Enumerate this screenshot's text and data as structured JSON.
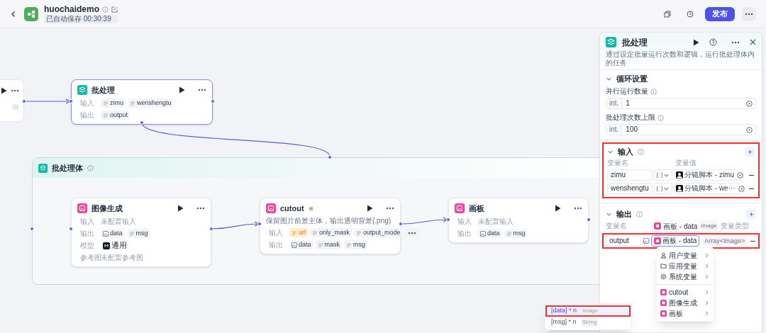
{
  "header": {
    "title": "huochaidemo",
    "autosave": "已自动保存 00:30:39",
    "publish": "发布"
  },
  "canvas": {
    "batch_node": {
      "kind": "batch",
      "color": "#14b8a6",
      "title": "批处理",
      "rows": [
        {
          "label": "输入",
          "chips": [
            {
              "kind": "text",
              "text": "zimu"
            },
            {
              "kind": "text",
              "text": "wenshengtu"
            }
          ]
        },
        {
          "label": "输出",
          "chips": [
            {
              "kind": "text",
              "text": "output"
            }
          ]
        }
      ]
    },
    "loop_body": {
      "title": "批处理体",
      "nodes": [
        {
          "kind": "plugin",
          "color": "#ec4899",
          "title": "图像生成",
          "rows": [
            {
              "label": "输入",
              "note": "未配置输入"
            },
            {
              "label": "输出",
              "chips": [
                {
                  "kind": "image",
                  "text": "data"
                },
                {
                  "kind": "text",
                  "text": "msg"
                }
              ]
            },
            {
              "label": "模型",
              "chips": [
                {
                  "kind": "model",
                  "text": "通用"
                }
              ]
            },
            {
              "label": "参考图",
              "note": "未配置参考图"
            }
          ]
        },
        {
          "kind": "plugin",
          "color": "#ec4899",
          "title": "cutout",
          "description": "保留图片前景主体，输出透明背景(.png)",
          "rows": [
            {
              "label": "输入",
              "chips": [
                {
                  "kind": "warn",
                  "text": "url"
                },
                {
                  "kind": "text",
                  "text": "only_mask"
                },
                {
                  "kind": "text",
                  "text": "output_mode"
                },
                {
                  "kind": "more"
                }
              ]
            },
            {
              "label": "输出",
              "chips": [
                {
                  "kind": "image",
                  "text": "data"
                },
                {
                  "kind": "text",
                  "text": "mask"
                },
                {
                  "kind": "text",
                  "text": "msg"
                }
              ]
            }
          ]
        },
        {
          "kind": "plugin",
          "color": "#ec4899",
          "title": "画板",
          "rows": [
            {
              "label": "输入",
              "note": "未配置输入"
            },
            {
              "label": "输出",
              "chips": [
                {
                  "kind": "image",
                  "text": "data"
                },
                {
                  "kind": "text",
                  "text": "msg"
                }
              ]
            }
          ]
        }
      ]
    }
  },
  "panel": {
    "title": "批处理",
    "description": "通过设定批量运行次数和逻辑，运行批处理体内的任务",
    "loop_settings": {
      "title": "循环设置",
      "fields": [
        {
          "label": "并行运行数量",
          "prefix": "int.",
          "value": "1"
        },
        {
          "label": "批处理次数上限",
          "prefix": "int.",
          "value": "100"
        }
      ]
    },
    "inputs": {
      "title": "输入",
      "highlighted": true,
      "columns": [
        "变量名",
        "变量值"
      ],
      "rows": [
        {
          "name": "zimu",
          "value": "分镜脚本 - zimu"
        },
        {
          "name": "wenshengtu",
          "value": "分镜脚本 - we···"
        }
      ]
    },
    "outputs": {
      "title": "输出",
      "columns": [
        "变量名",
        "变量类型"
      ],
      "rows": [
        {
          "name": "output",
          "value": "画板 - data",
          "type": "Array<Image>",
          "highlighted": true
        }
      ],
      "tooltip": {
        "text": "画板 - data",
        "type": "Image"
      },
      "menu": [
        {
          "kind": "user",
          "label": "用户变量"
        },
        {
          "kind": "folder",
          "label": "应用变量"
        },
        {
          "kind": "system",
          "label": "系统变量"
        },
        {
          "kind": "node",
          "label": "cutout"
        },
        {
          "kind": "node",
          "label": "图像生成"
        },
        {
          "kind": "node",
          "label": "画板"
        }
      ],
      "submenu": [
        {
          "label": "[data] * n",
          "type": "Image",
          "selected": true,
          "highlighted": true
        },
        {
          "label": "[msg] * n",
          "type": "String",
          "selected": false,
          "highlighted": false
        }
      ]
    }
  }
}
